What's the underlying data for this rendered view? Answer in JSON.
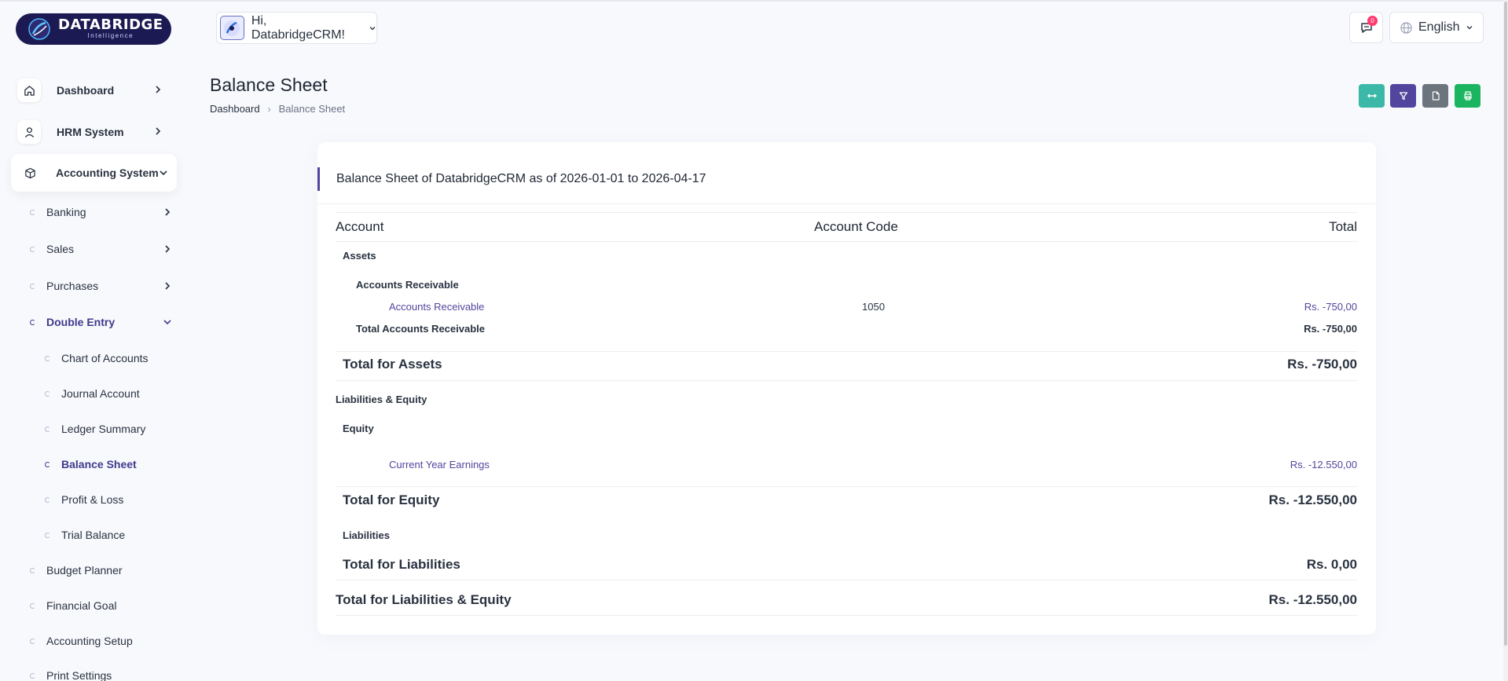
{
  "brand": {
    "name": "DATABRIDGE",
    "tagline": "Intelligence"
  },
  "header": {
    "greeting": "Hi, DatabridgeCRM!",
    "notification_count": "0",
    "language": "English"
  },
  "sidebar": {
    "top_items": [
      {
        "label": "Dashboard",
        "icon": "home-icon"
      },
      {
        "label": "HRM System",
        "icon": "user-icon"
      },
      {
        "label": "Accounting System",
        "icon": "box-icon"
      }
    ],
    "accounting_items": [
      {
        "label": "Banking"
      },
      {
        "label": "Sales"
      },
      {
        "label": "Purchases"
      },
      {
        "label": "Double Entry"
      }
    ],
    "double_entry_items": [
      {
        "label": "Chart of Accounts"
      },
      {
        "label": "Journal Account"
      },
      {
        "label": "Ledger Summary"
      },
      {
        "label": "Balance Sheet"
      },
      {
        "label": "Profit & Loss"
      },
      {
        "label": "Trial Balance"
      }
    ],
    "more_items": [
      {
        "label": "Budget Planner"
      },
      {
        "label": "Financial Goal"
      },
      {
        "label": "Accounting Setup"
      },
      {
        "label": "Print Settings"
      }
    ]
  },
  "page": {
    "title": "Balance Sheet",
    "breadcrumb": [
      "Dashboard",
      "Balance Sheet"
    ],
    "actions": [
      {
        "name": "collapse-button",
        "icon": "arrows-icon",
        "color": "#3cb8a8"
      },
      {
        "name": "filter-button",
        "icon": "filter-icon",
        "color": "#51459d"
      },
      {
        "name": "export-button",
        "icon": "file-icon",
        "color": "#6c757d"
      },
      {
        "name": "print-button",
        "icon": "printer-icon",
        "color": "#1cb55f"
      }
    ]
  },
  "report": {
    "title": "Balance Sheet of DatabridgeCRM as of 2026-01-01 to 2026-04-17",
    "columns": {
      "account": "Account",
      "code": "Account Code",
      "total": "Total"
    },
    "assets": {
      "label": "Assets",
      "group_label": "Accounts Receivable",
      "account_name": "Accounts Receivable",
      "account_code": "1050",
      "account_total": "Rs. -750,00",
      "group_total_label": "Total Accounts Receivable",
      "group_total": "Rs. -750,00",
      "total_label": "Total for Assets",
      "total": "Rs. -750,00"
    },
    "liabilities_equity": {
      "label": "Liabilities & Equity",
      "equity_label": "Equity",
      "earnings_name": "Current Year Earnings",
      "earnings_total": "Rs. -12.550,00",
      "equity_total_label": "Total for Equity",
      "equity_total": "Rs. -12.550,00",
      "liabilities_label": "Liabilities",
      "liabilities_total_label": "Total for Liabilities",
      "liabilities_total": "Rs. 0,00",
      "total_label": "Total for Liabilities & Equity",
      "total": "Rs. -12.550,00"
    }
  }
}
